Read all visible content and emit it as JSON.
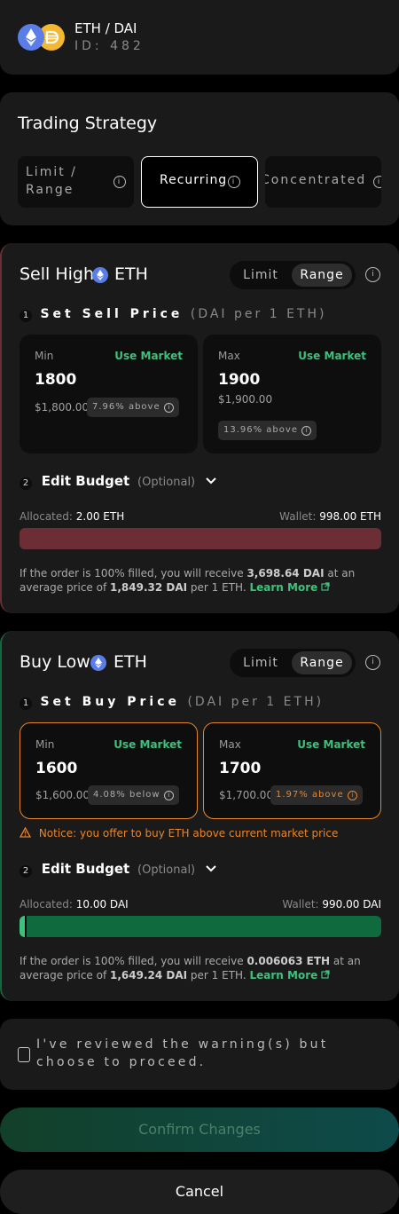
{
  "header": {
    "pair": "ETH / DAI",
    "id_text": "ID: 482",
    "eth_icon": "ethereum-token-icon",
    "dai_icon": "dai-token-icon"
  },
  "strategy": {
    "title": "Trading Strategy",
    "options": [
      "Limit / Range",
      "Recurring",
      "Concentrated"
    ],
    "selected": "Recurring"
  },
  "sell": {
    "title": "Sell High",
    "token": "ETH",
    "toggle": [
      "Limit",
      "Range"
    ],
    "toggle_selected": "Range",
    "step1_num": "1",
    "step1_label": "Set Sell Price",
    "step1_unit": "(DAI per 1 ETH)",
    "min": {
      "label": "Min",
      "use_market": "Use Market",
      "value": "1800",
      "fiat": "$1,800.00",
      "badge": "7.96% above"
    },
    "max": {
      "label": "Max",
      "use_market": "Use Market",
      "value": "1900",
      "fiat": "$1,900.00",
      "badge": "13.96% above"
    },
    "step2_num": "2",
    "step2_label": "Edit Budget",
    "step2_optional": "(Optional)",
    "allocated_label": "Allocated:",
    "allocated_value": "2.00 ETH",
    "wallet_label": "Wallet:",
    "wallet_value": "998.00 ETH",
    "allocation_fraction": 1.0,
    "summary_pre": "If the order is 100% filled, you will receive ",
    "summary_amount": "3,698.64 DAI",
    "summary_mid": " at an average price of ",
    "summary_price": "1,849.32 DAI",
    "summary_post": " per 1 ETH. ",
    "learn_more": "Learn More"
  },
  "buy": {
    "title": "Buy Low",
    "token": "ETH",
    "toggle": [
      "Limit",
      "Range"
    ],
    "toggle_selected": "Range",
    "step1_num": "1",
    "step1_label": "Set Buy Price",
    "step1_unit": "(DAI per 1 ETH)",
    "min": {
      "label": "Min",
      "use_market": "Use Market",
      "value": "1600",
      "fiat": "$1,600.00",
      "badge": "4.08% below"
    },
    "max": {
      "label": "Max",
      "use_market": "Use Market",
      "value": "1700",
      "fiat": "$1,700.00",
      "badge": "1.97% above"
    },
    "notice": "Notice: you offer to buy ETH above current market price",
    "step2_num": "2",
    "step2_label": "Edit Budget",
    "step2_optional": "(Optional)",
    "allocated_label": "Allocated:",
    "allocated_value": "10.00 DAI",
    "wallet_label": "Wallet:",
    "wallet_value": "990.00 DAI",
    "allocation_fraction": 0.01,
    "summary_pre": "If the order is 100% filled, you will receive ",
    "summary_amount": "0.006063 ETH",
    "summary_mid": " at an average price of ",
    "summary_price": "1,649.24 DAI",
    "summary_post": " per 1 ETH. ",
    "learn_more": "Learn More"
  },
  "confirm_warning": "I've reviewed the warning(s) but choose to proceed.",
  "confirm_button": "Confirm Changes",
  "cancel_button": "Cancel",
  "colors": {
    "sell_accent": "#6b2e35",
    "buy_accent": "#0f6b3e",
    "positive": "#3fc07d",
    "warning": "#e8852a"
  }
}
